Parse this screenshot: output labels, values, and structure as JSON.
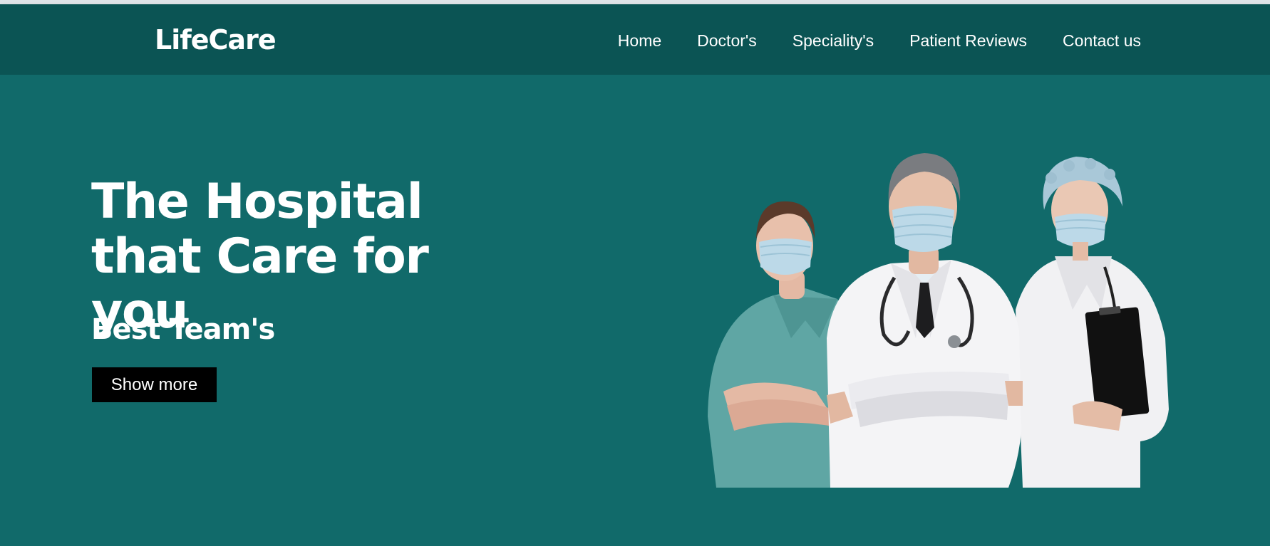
{
  "brand": {
    "name": "LifeCare"
  },
  "nav": {
    "items": [
      {
        "label": "Home"
      },
      {
        "label": "Doctor's"
      },
      {
        "label": "Speciality's"
      },
      {
        "label": "Patient Reviews"
      },
      {
        "label": "Contact us"
      }
    ]
  },
  "hero": {
    "title": "The Hospital that Care for you",
    "subtitle": "Best Team's",
    "cta_label": "Show more"
  },
  "colors": {
    "navbar": "#0b5454",
    "hero_background": "#116a6a",
    "cta_background": "#000000",
    "text": "#ffffff"
  }
}
